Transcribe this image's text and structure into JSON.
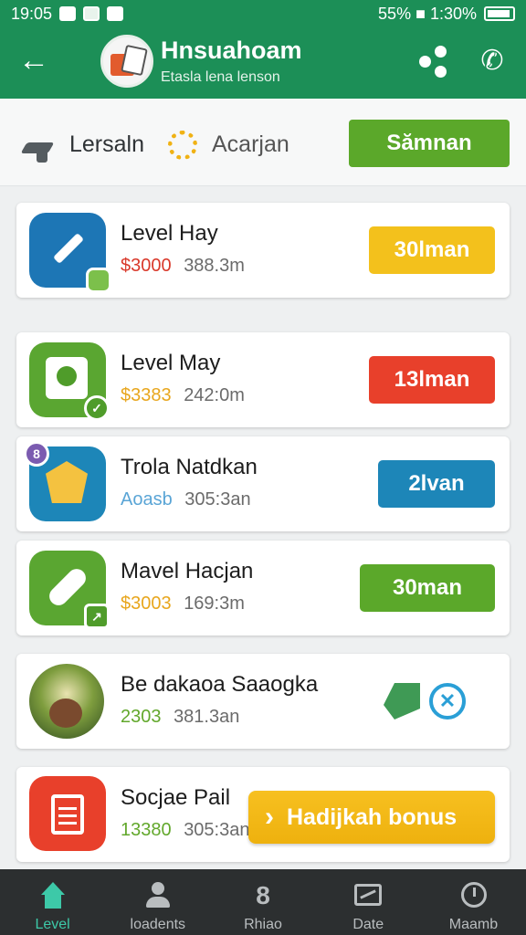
{
  "status": {
    "time": "19:05",
    "left_icons": [
      "mail-icon",
      "clock-icon",
      "notification-icon"
    ],
    "right_text": "55% ■ 1:30%"
  },
  "header": {
    "title": "Hnsuahoam",
    "subtitle": "Etasla lena lenson",
    "back_icon": "back-arrow-icon",
    "actions": [
      "share-icon",
      "phone-icon"
    ]
  },
  "filters": {
    "label1": "Lersaln",
    "label2": "Acarjan",
    "button": "Sămnan"
  },
  "items": [
    {
      "title": "Level Hay",
      "price": "$3000",
      "size": "388.3m",
      "button": "30lman",
      "price_color": "#d9382a",
      "icon": "edit-icon"
    },
    {
      "title": "Level May",
      "price": "$3383",
      "size": "242:0m",
      "button": "13lman",
      "price_color": "#e8a61d",
      "icon": "document-icon"
    },
    {
      "title": "Trola Natdkan",
      "price": "Aoasb",
      "size": "305:3an",
      "button": "2lvan",
      "price_color": "#5aa5d6",
      "icon": "cube-icon",
      "badge": "8"
    },
    {
      "title": "Mavel Hacjan",
      "price": "$3003",
      "size": "169:3m",
      "button": "30man",
      "price_color": "#e8a61d",
      "icon": "bandage-icon"
    },
    {
      "title": "Be dakaoa Saaogka",
      "price": "2303",
      "size": "381.3an",
      "price_color": "#62a82c",
      "icon": "photo-icon"
    },
    {
      "title": "Socjae Pail",
      "price": "13380",
      "size": "305:3an",
      "price_color": "#62a82c",
      "icon": "clipboard-icon"
    }
  ],
  "bonus": {
    "label": "Hadijkah bonus",
    "icon": "chevron-right-icon"
  },
  "nav": [
    {
      "label": "Level",
      "icon": "home-icon",
      "active": true
    },
    {
      "label": "loadents",
      "icon": "user-icon"
    },
    {
      "label": "Rhiao",
      "icon": "number-icon"
    },
    {
      "label": "Date",
      "icon": "chart-icon"
    },
    {
      "label": "Maamb",
      "icon": "clock-icon"
    }
  ],
  "colors": {
    "primary_green": "#1c8f57",
    "button_yellow": "#f3c11c",
    "button_red": "#e8402b",
    "button_blue": "#1d86b8",
    "button_green": "#5ba82a",
    "nav_active": "#3dc9a8"
  }
}
